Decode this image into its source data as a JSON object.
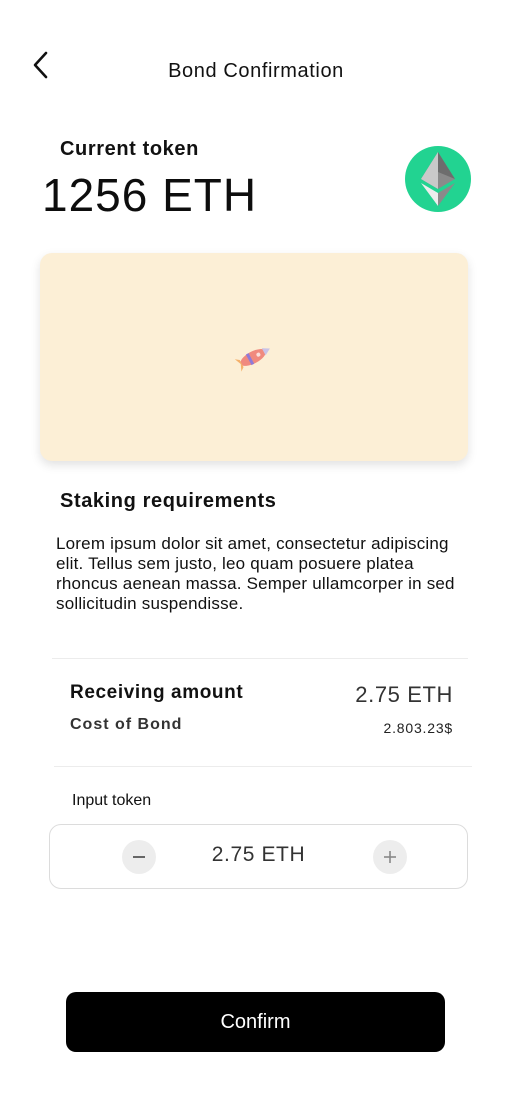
{
  "header": {
    "title": "Bond Confirmation",
    "back_icon": "chevron-left-icon"
  },
  "token": {
    "label": "Current token",
    "amount": "1256 ETH",
    "icon": "ethereum-icon",
    "icon_bg": "#22d391"
  },
  "banner": {
    "bg": "#fcefd6",
    "illustration": "rocket-icon"
  },
  "requirements": {
    "title": "Staking requirements",
    "body": "Lorem ipsum dolor sit amet, consectetur adipiscing elit. Tellus sem justo, leo quam posuere platea rhoncus aenean massa. Semper ullamcorper in sed sollicitudin suspendisse."
  },
  "summary": {
    "receiving_label": "Receiving amount",
    "receiving_value": "2.75 ETH",
    "cost_label": "Cost of Bond",
    "cost_value": "2.803.23$"
  },
  "input": {
    "label": "Input token",
    "value": "2.75 ETH",
    "minus_icon": "minus-icon",
    "plus_icon": "plus-icon"
  },
  "actions": {
    "confirm_label": "Confirm"
  }
}
